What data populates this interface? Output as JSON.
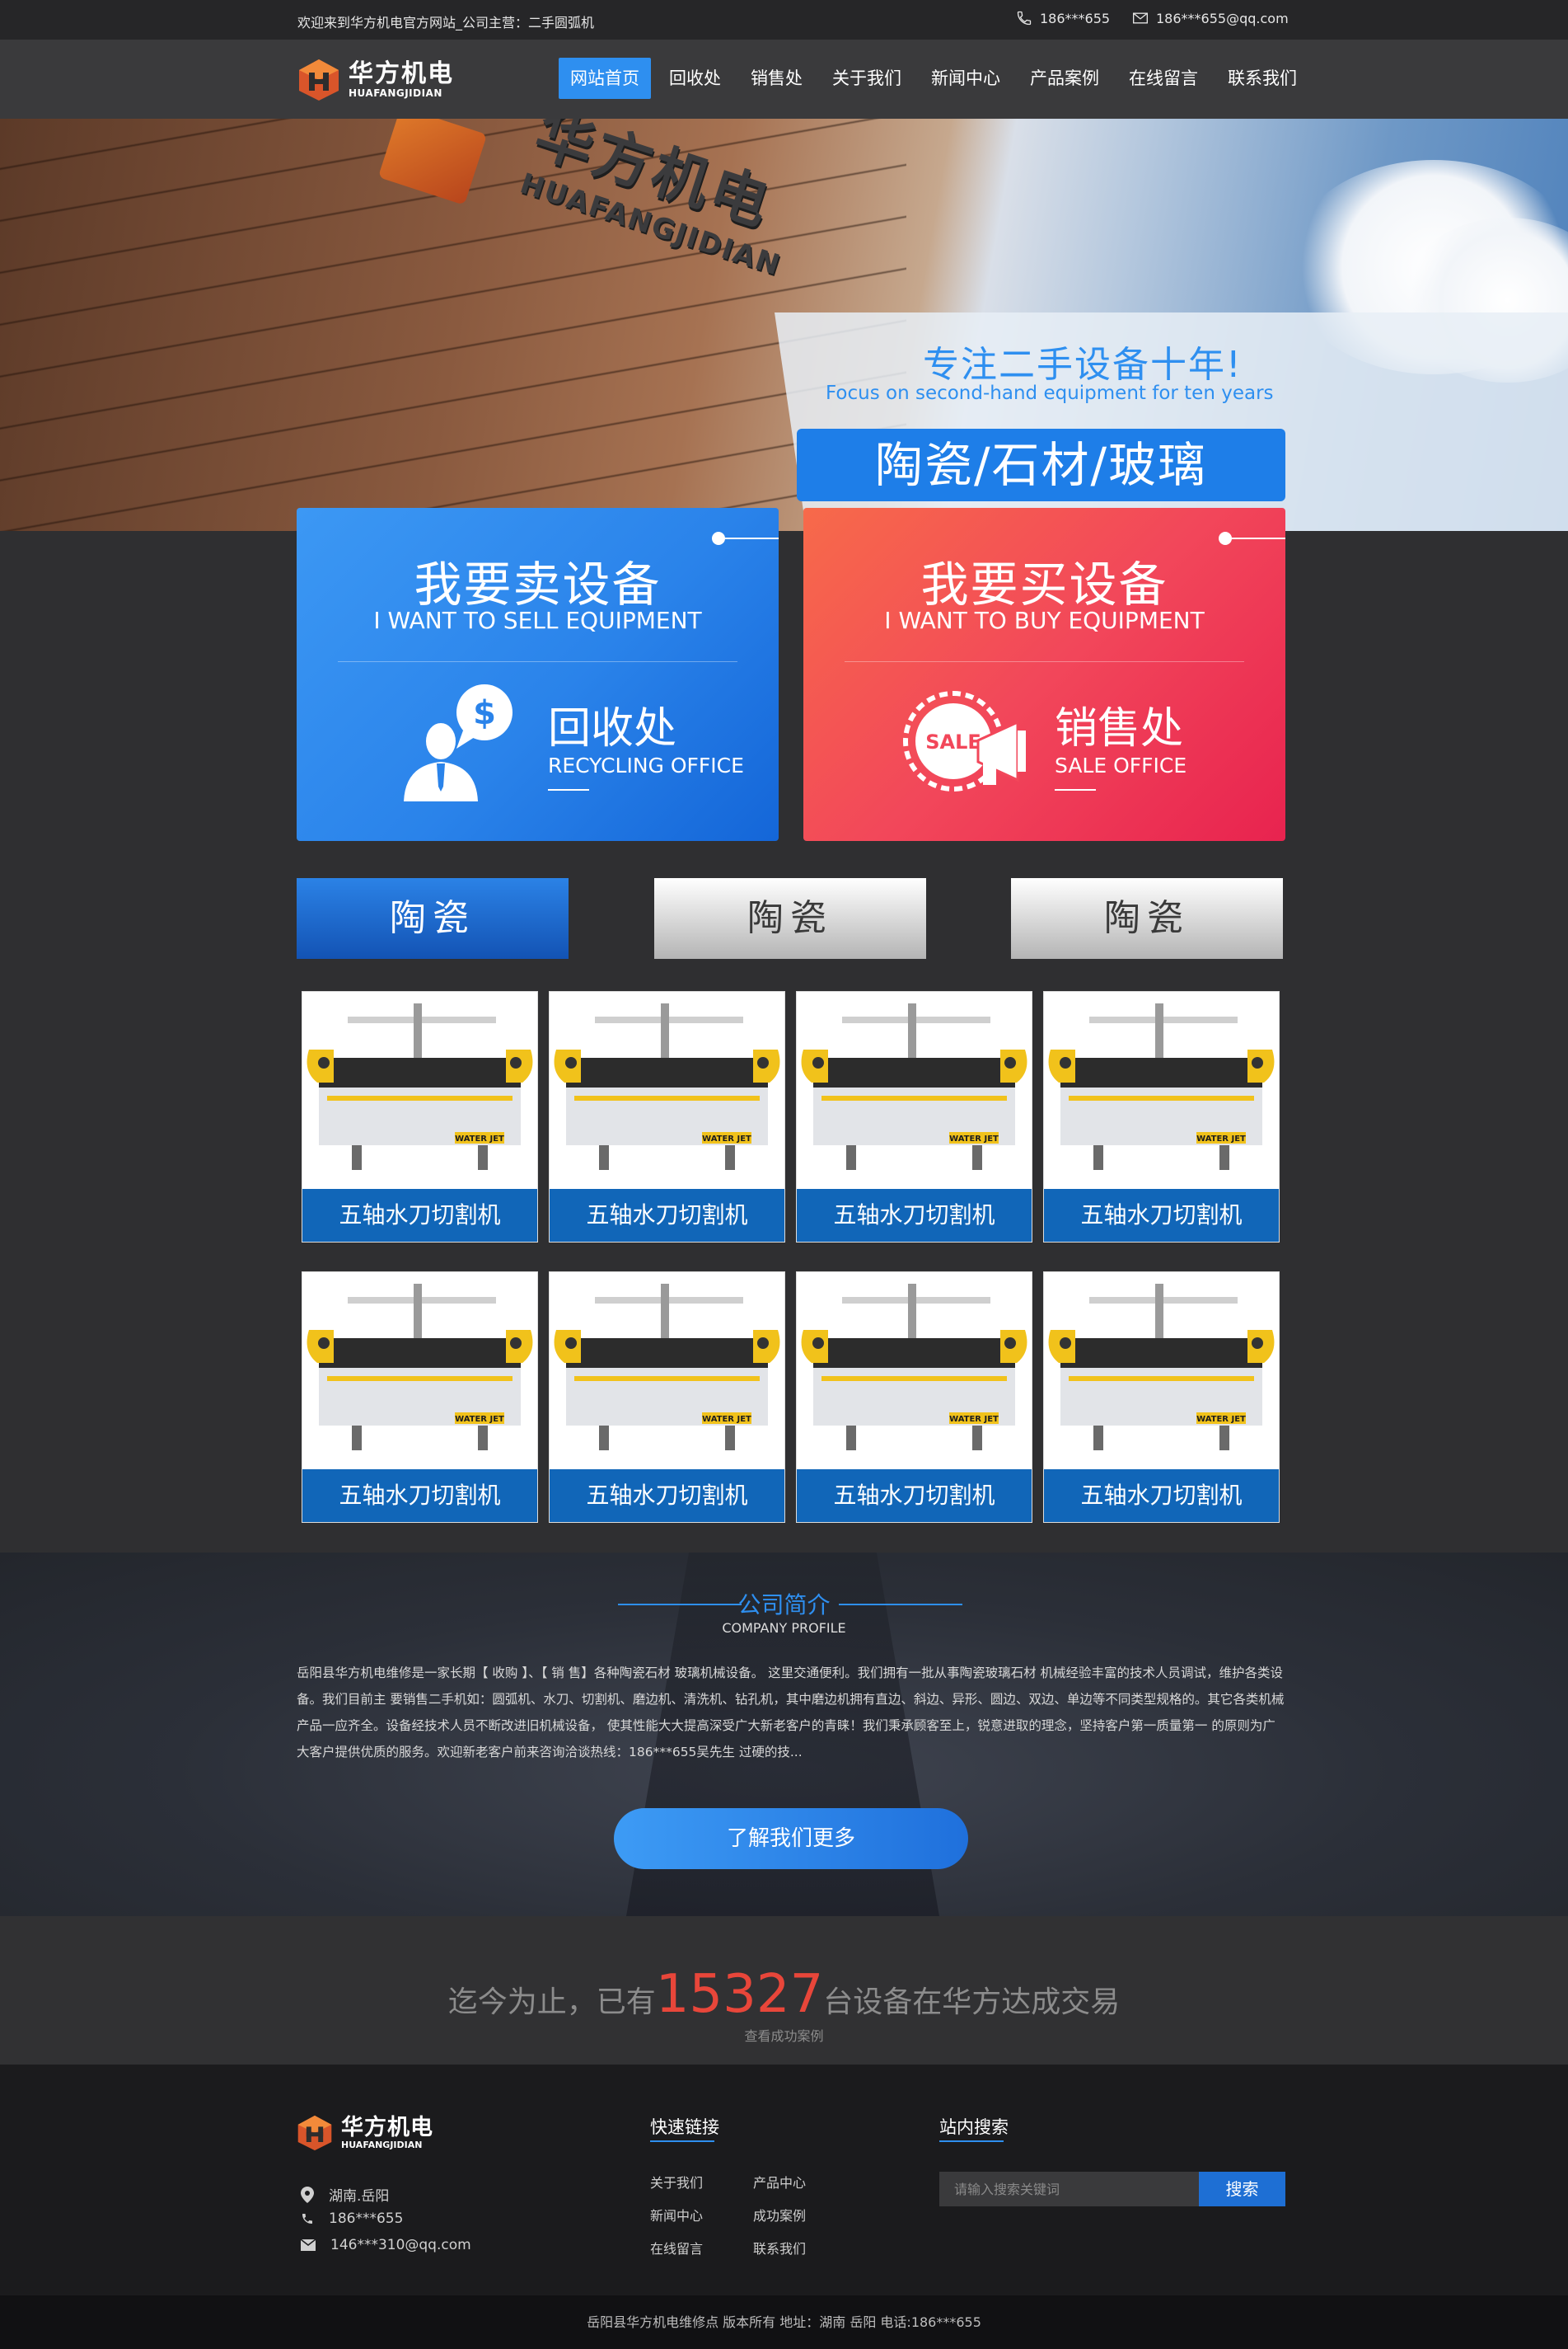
{
  "topbar": {
    "welcome": "欢迎来到华方机电官方网站_公司主营：二手圆弧机",
    "phone": "186***655",
    "email": "186***655@qq.com"
  },
  "brand": {
    "name_cn": "华方机电",
    "name_en": "HUAFANGJIDIAN"
  },
  "nav": {
    "items": [
      {
        "label": "网站首页",
        "active": true
      },
      {
        "label": "回收处"
      },
      {
        "label": "销售处"
      },
      {
        "label": "关于我们"
      },
      {
        "label": "新闻中心"
      },
      {
        "label": "产品案例"
      },
      {
        "label": "在线留言"
      },
      {
        "label": "联系我们"
      }
    ]
  },
  "banner": {
    "sign_cn": "华方机电",
    "sign_en": "HUAFANGJIDIAN",
    "focus_cn": "专注二手设备十年!",
    "focus_en": "Focus on second-hand equipment for ten years",
    "categories": "陶瓷/石材/玻璃"
  },
  "services": {
    "sell": {
      "title_cn": "我要卖设备",
      "title_en": "I WANT TO SELL EQUIPMENT",
      "sub_cn": "回收处",
      "sub_en": "RECYCLING OFFICE",
      "icon": "person-dollar-icon",
      "color": "#2a83ea"
    },
    "buy": {
      "title_cn": "我要买设备",
      "title_en": "I WANT TO BUY EQUIPMENT",
      "sub_cn": "销售处",
      "sub_en": "SALE OFFICE",
      "icon": "sale-megaphone-icon",
      "badge": "SALE",
      "color": "#f2475a"
    }
  },
  "tabs": [
    {
      "label": "陶瓷",
      "active": true
    },
    {
      "label": "陶瓷"
    },
    {
      "label": "陶瓷"
    }
  ],
  "products": [
    {
      "name": "五轴水刀切割机",
      "brand": "WATER JET"
    },
    {
      "name": "五轴水刀切割机",
      "brand": "WATER JET"
    },
    {
      "name": "五轴水刀切割机",
      "brand": "WATER JET"
    },
    {
      "name": "五轴水刀切割机",
      "brand": "WATER JET"
    },
    {
      "name": "五轴水刀切割机",
      "brand": "WATER JET"
    },
    {
      "name": "五轴水刀切割机",
      "brand": "WATER JET"
    },
    {
      "name": "五轴水刀切割机",
      "brand": "WATER JET"
    },
    {
      "name": "五轴水刀切割机",
      "brand": "WATER JET"
    }
  ],
  "profile": {
    "title_cn": "公司简介",
    "title_en": "COMPANY PROFILE",
    "text": "岳阳县华方机电维修是一家长期【 收购 】、【 销 售】各种陶瓷石材 玻璃机械设备。 这里交通便利。我们拥有一批从事陶瓷玻璃石材 机械经验丰富的技术人员调试，维护各类设备。我们目前主 要销售二手机如：圆弧机、水刀、切割机、磨边机、清洗机、钻孔机，其中磨边机拥有直边、斜边、异形、圆边、双边、单边等不同类型规格的。其它各类机械产品一应齐全。设备经技术人员不断改进旧机械设备， 使其性能大大提高深受广大新老客户的青睐！我们秉承顾客至上，锐意进取的理念，坚持客户第一质量第一 的原则为广大客户提供优质的服务。欢迎新老客户前来咨询洽谈热线：186***655吴先生 过硬的技...",
    "more_label": "了解我们更多"
  },
  "stats": {
    "prefix": "迄今为止，已有",
    "count": "15327",
    "suffix": "台设备在华方达成交易",
    "link": "查看成功案例"
  },
  "footer": {
    "address": "湖南.岳阳",
    "phone": "186***655",
    "email": "146***310@qq.com",
    "quick_links_title": "快速链接",
    "links": [
      "关于我们",
      "产品中心",
      "新闻中心",
      "成功案例",
      "在线留言",
      "联系我们"
    ],
    "search_title": "站内搜索",
    "search_placeholder": "请输入搜索关键词",
    "search_button": "搜索",
    "copyright": "岳阳县华方机电维修点 版本所有 地址：湖南 岳阳 电话:186***655"
  }
}
